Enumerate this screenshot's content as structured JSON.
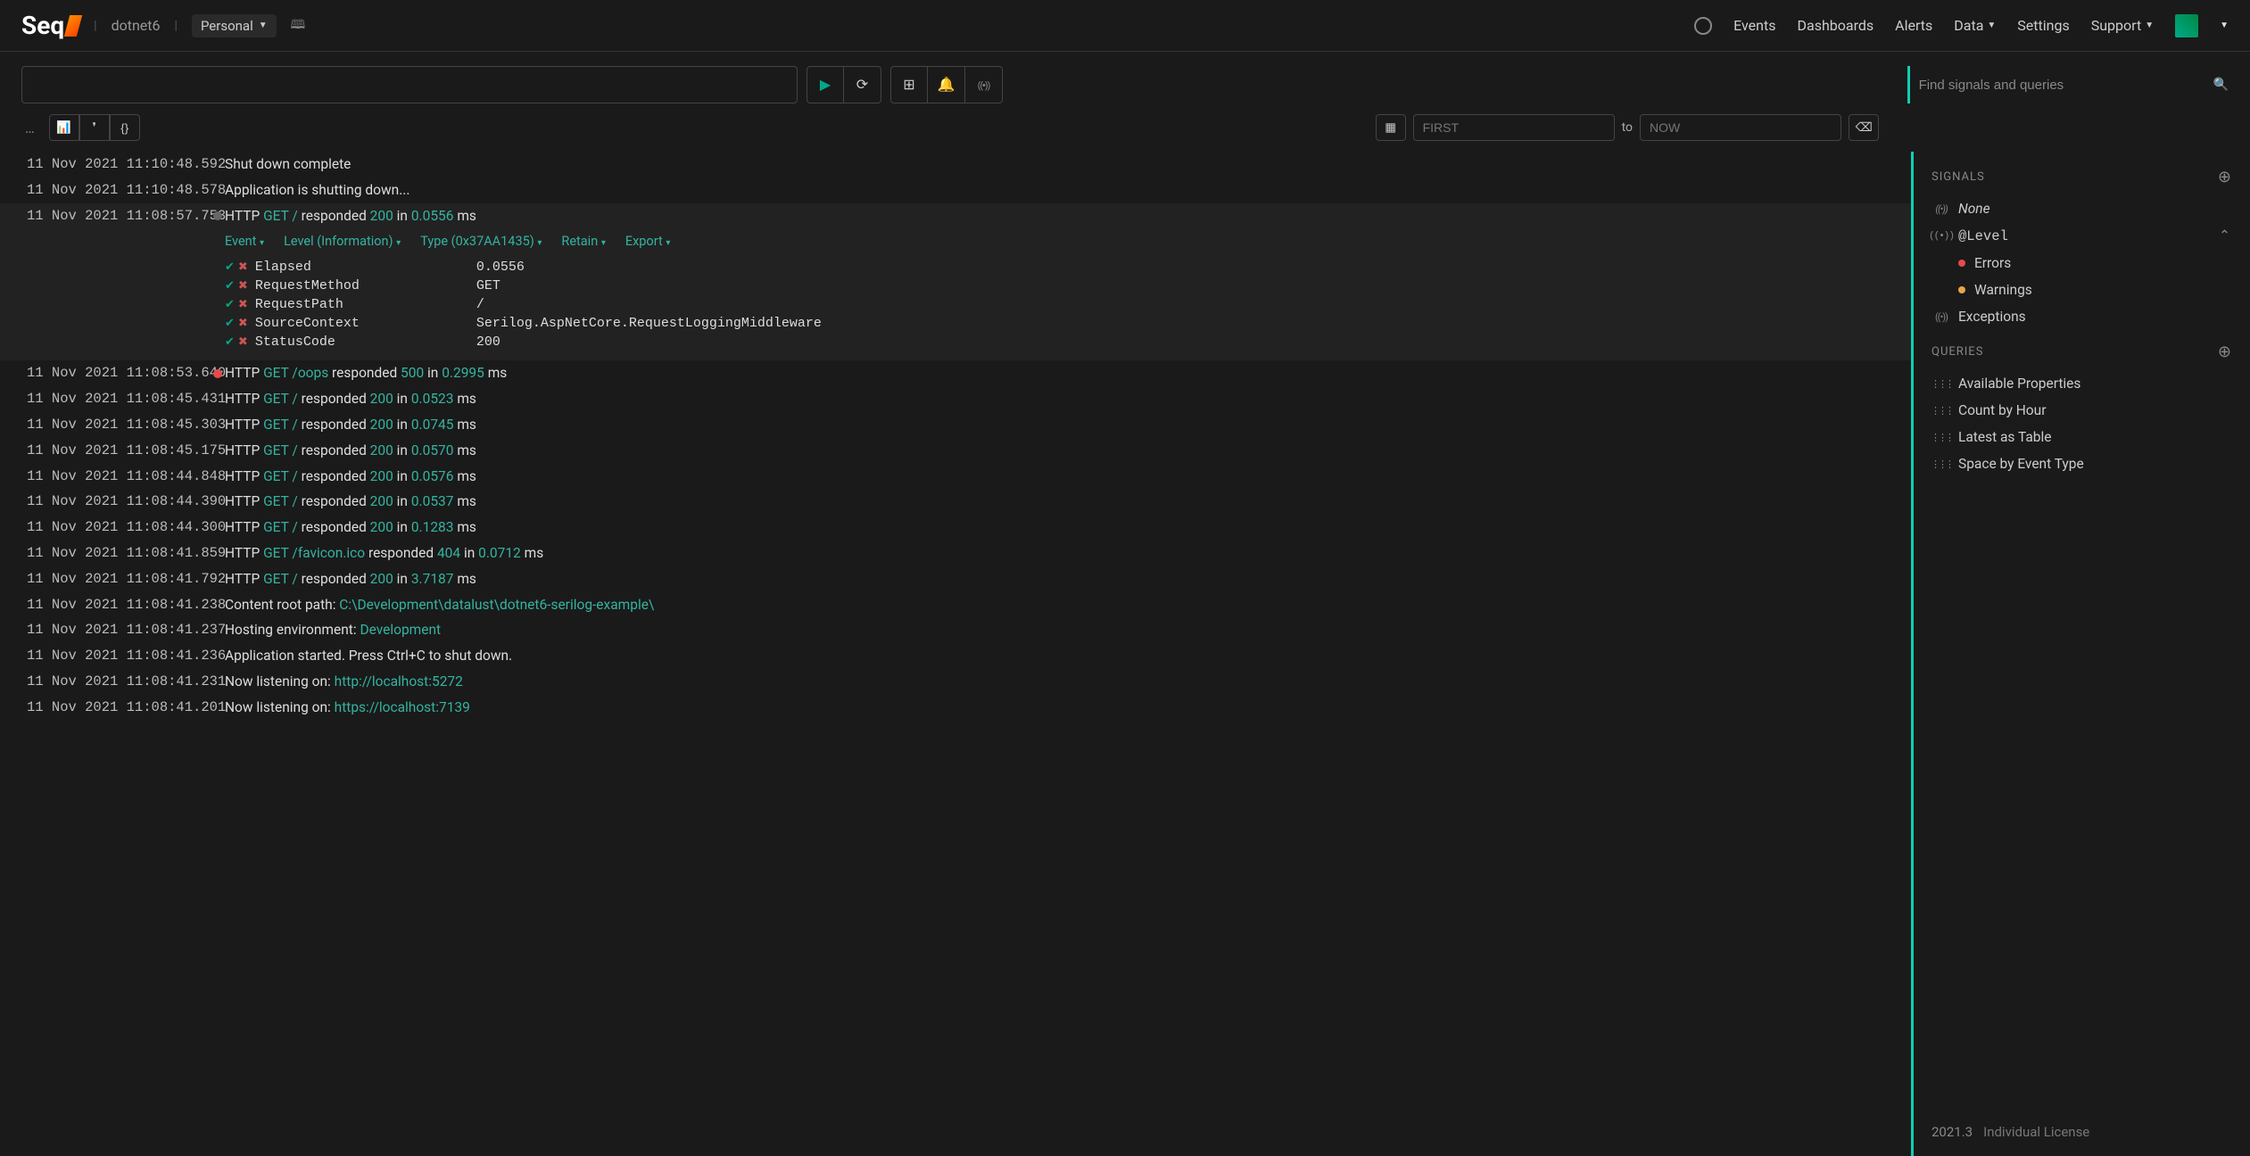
{
  "header": {
    "logo_text": "Seq",
    "breadcrumb": "dotnet6",
    "workspace": "Personal",
    "nav": {
      "events": "Events",
      "dashboards": "Dashboards",
      "alerts": "Alerts",
      "data": "Data",
      "settings": "Settings",
      "support": "Support"
    }
  },
  "toolbar": {
    "search_value": "",
    "signals_placeholder": "Find signals and queries"
  },
  "sub": {
    "ellipsis": "…",
    "from_placeholder": "FIRST",
    "to_label": "to",
    "to_placeholder": "NOW"
  },
  "expanded": {
    "menus": {
      "event": "Event",
      "level": "Level (Information)",
      "type": "Type (0x37AA1435)",
      "retain": "Retain",
      "export": "Export"
    },
    "props": [
      {
        "key": "Elapsed",
        "val": "0.0556"
      },
      {
        "key": "RequestMethod",
        "val": "GET"
      },
      {
        "key": "RequestPath",
        "val": "/"
      },
      {
        "key": "SourceContext",
        "val": "Serilog.AspNetCore.RequestLoggingMiddleware"
      },
      {
        "key": "StatusCode",
        "val": "200"
      }
    ]
  },
  "events": [
    {
      "ts": "11 Nov 2021 11:10:48.592",
      "marker": "",
      "msg": "Shut down complete"
    },
    {
      "ts": "11 Nov 2021 11:10:48.578",
      "marker": "",
      "msg": "Application is shutting down..."
    },
    {
      "ts": "11 Nov 2021 11:08:57.753",
      "marker": "gray",
      "template": "http",
      "method": "GET",
      "path": "/",
      "status": "200",
      "elapsed": "0.0556",
      "expanded": true
    },
    {
      "ts": "11 Nov 2021 11:08:53.640",
      "marker": "red",
      "template": "http",
      "method": "GET",
      "path": "/oops",
      "status": "500",
      "elapsed": "0.2995"
    },
    {
      "ts": "11 Nov 2021 11:08:45.431",
      "marker": "",
      "template": "http",
      "method": "GET",
      "path": "/",
      "status": "200",
      "elapsed": "0.0523"
    },
    {
      "ts": "11 Nov 2021 11:08:45.303",
      "marker": "",
      "template": "http",
      "method": "GET",
      "path": "/",
      "status": "200",
      "elapsed": "0.0745"
    },
    {
      "ts": "11 Nov 2021 11:08:45.175",
      "marker": "",
      "template": "http",
      "method": "GET",
      "path": "/",
      "status": "200",
      "elapsed": "0.0570"
    },
    {
      "ts": "11 Nov 2021 11:08:44.848",
      "marker": "",
      "template": "http",
      "method": "GET",
      "path": "/",
      "status": "200",
      "elapsed": "0.0576"
    },
    {
      "ts": "11 Nov 2021 11:08:44.390",
      "marker": "",
      "template": "http",
      "method": "GET",
      "path": "/",
      "status": "200",
      "elapsed": "0.0537"
    },
    {
      "ts": "11 Nov 2021 11:08:44.300",
      "marker": "",
      "template": "http",
      "method": "GET",
      "path": "/",
      "status": "200",
      "elapsed": "0.1283"
    },
    {
      "ts": "11 Nov 2021 11:08:41.859",
      "marker": "",
      "template": "http",
      "method": "GET",
      "path": "/favicon.ico",
      "status": "404",
      "elapsed": "0.0712"
    },
    {
      "ts": "11 Nov 2021 11:08:41.792",
      "marker": "",
      "template": "http",
      "method": "GET",
      "path": "/",
      "status": "200",
      "elapsed": "3.7187"
    },
    {
      "ts": "11 Nov 2021 11:08:41.238",
      "marker": "",
      "template": "kv",
      "prefix": "Content root path: ",
      "value": "C:\\Development\\datalust\\dotnet6-serilog-example\\"
    },
    {
      "ts": "11 Nov 2021 11:08:41.237",
      "marker": "",
      "template": "kv",
      "prefix": "Hosting environment: ",
      "value": "Development"
    },
    {
      "ts": "11 Nov 2021 11:08:41.236",
      "marker": "",
      "msg": "Application started. Press Ctrl+C to shut down."
    },
    {
      "ts": "11 Nov 2021 11:08:41.231",
      "marker": "",
      "template": "kv",
      "prefix": "Now listening on: ",
      "value": "http://localhost:5272"
    },
    {
      "ts": "11 Nov 2021 11:08:41.201",
      "marker": "",
      "template": "kv",
      "prefix": "Now listening on: ",
      "value": "https://localhost:7139"
    }
  ],
  "signals": {
    "heading": "SIGNALS",
    "none": "None",
    "level": "@Level",
    "errors": "Errors",
    "warnings": "Warnings",
    "exceptions": "Exceptions"
  },
  "queries": {
    "heading": "QUERIES",
    "items": [
      "Available Properties",
      "Count by Hour",
      "Latest as Table",
      "Space by Event Type"
    ]
  },
  "footer": {
    "version": "2021.3",
    "license": "Individual License"
  },
  "words": {
    "http": "HTTP",
    "responded": "responded",
    "in": "in",
    "ms": "ms"
  }
}
